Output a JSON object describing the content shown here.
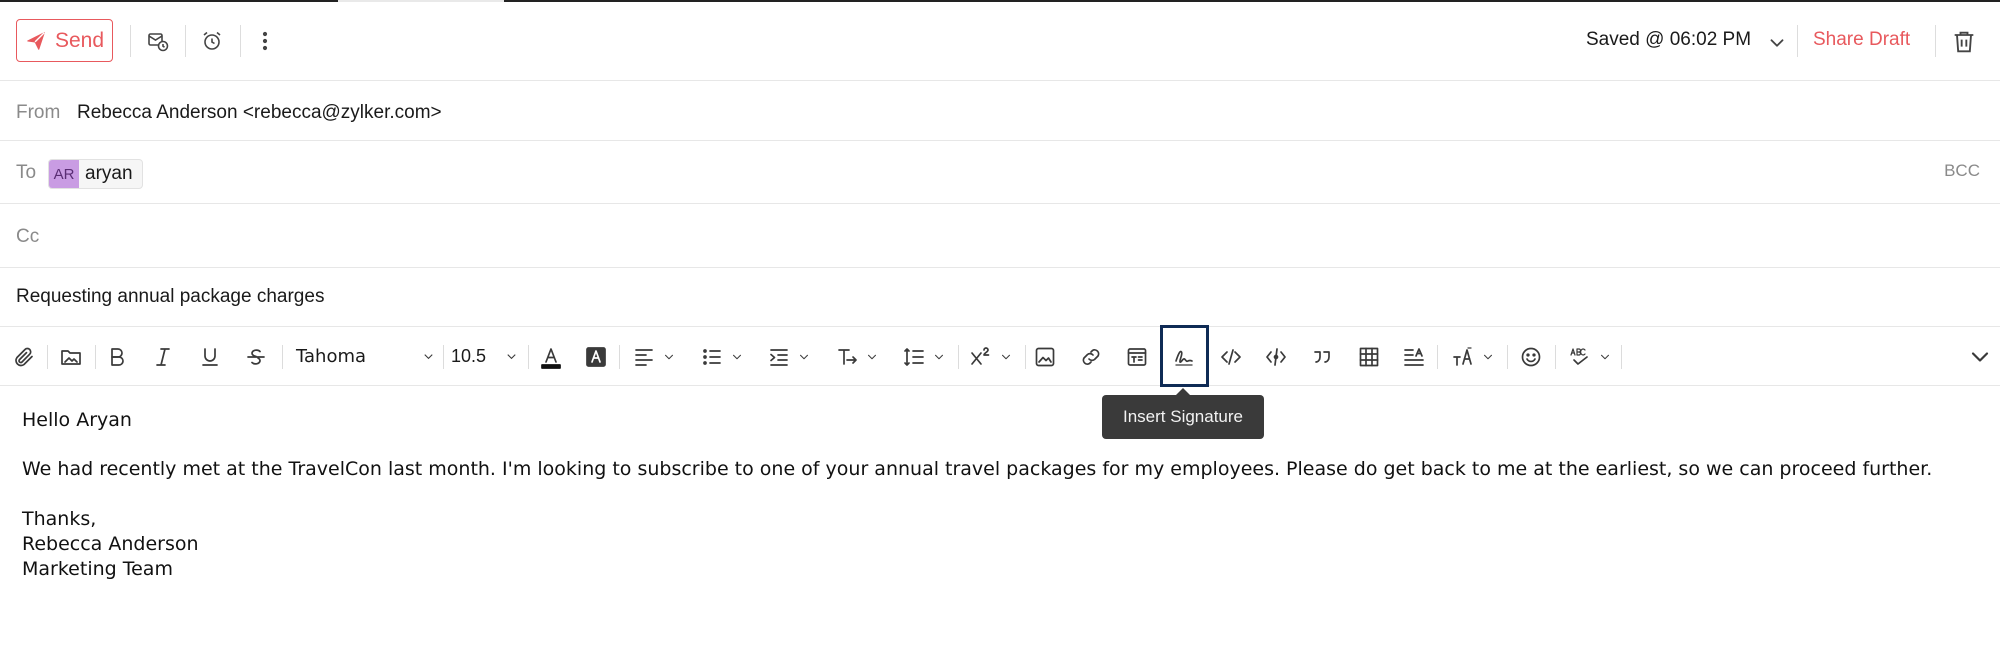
{
  "actions": {
    "send_label": "Send",
    "saved_status": "Saved @ 06:02 PM",
    "share_draft_label": "Share Draft",
    "icons": [
      "paper-plane-icon",
      "schedule-send-icon",
      "alarm-clock-icon",
      "more-vertical-icon",
      "chevron-down-icon",
      "trash-icon"
    ]
  },
  "header": {
    "from_label": "From",
    "from_value": "Rebecca Anderson <rebecca@zylker.com>",
    "to_label": "To",
    "to_recipients": [
      {
        "initials": "AR",
        "name": "aryan"
      }
    ],
    "bcc_label": "BCC",
    "cc_label": "Cc",
    "subject": "Requesting annual package charges"
  },
  "toolbar": {
    "font_family": "Tahoma",
    "font_size": "10.5",
    "tooltip": "Insert Signature",
    "highlighted_tool": "insert-signature"
  },
  "body": {
    "greeting": "Hello Aryan",
    "paragraph": "We had recently met at the TravelCon last month. I'm looking to subscribe to one of your annual travel packages for my employees. Please do get back to me at the earliest, so we can proceed further.",
    "closing": "Thanks,",
    "signature_name": "Rebecca Anderson",
    "signature_team": "Marketing Team"
  },
  "colors": {
    "accent": "#e8595d",
    "avatar_bg": "#c99ce3",
    "highlight_border": "#0f2b55",
    "tooltip_bg": "#3a3a3a"
  }
}
